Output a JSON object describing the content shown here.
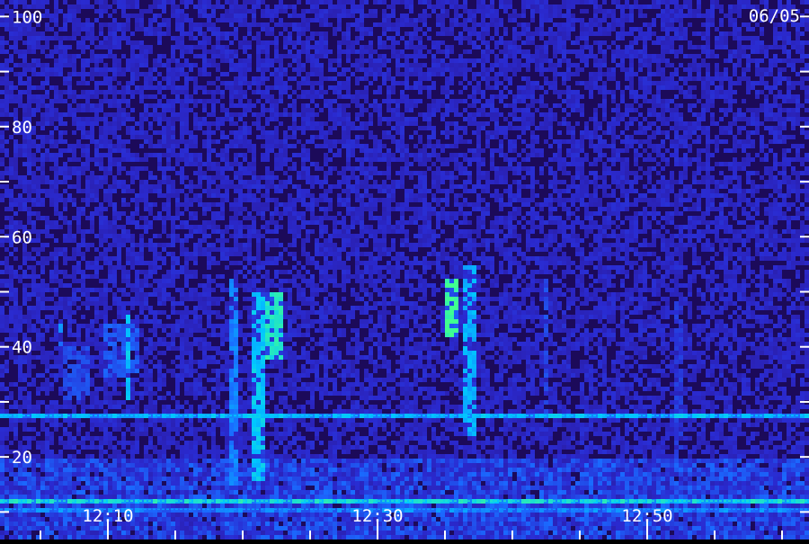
{
  "chart_data": {
    "type": "heatmap",
    "title": "",
    "date_label": "06/05",
    "xlabel": "",
    "ylabel": "",
    "x_tick_labels": [
      "12:10",
      "12:30",
      "12:50"
    ],
    "x_tick_minutes": [
      10,
      30,
      50
    ],
    "x_range_minutes": [
      2,
      62
    ],
    "x_minor_step_minutes": 5,
    "y_tick_labels": [
      "20",
      "40",
      "60",
      "80",
      "100"
    ],
    "y_ticks": [
      20,
      40,
      60,
      80,
      100
    ],
    "y_minor_ticks": [
      10,
      30,
      50,
      70,
      90
    ],
    "ylim": [
      5,
      103
    ],
    "grid": false,
    "colormap": [
      "#0a0330",
      "#2a0f7a",
      "#2a2ad0",
      "#1a6aff",
      "#00c8ff",
      "#40ff90"
    ],
    "features": [
      {
        "kind": "emission_band",
        "t_start": 6.2,
        "t_end": 6.6,
        "f_low": 38,
        "f_high": 44,
        "intensity": 0.6
      },
      {
        "kind": "emission_band",
        "t_start": 6.8,
        "t_end": 8.6,
        "f_low": 30,
        "f_high": 40,
        "intensity": 0.45
      },
      {
        "kind": "emission_band",
        "t_start": 9.6,
        "t_end": 12.2,
        "f_low": 34,
        "f_high": 44,
        "intensity": 0.5
      },
      {
        "kind": "emission_band",
        "t_start": 11.2,
        "t_end": 11.6,
        "f_low": 30,
        "f_high": 46,
        "intensity": 0.75
      },
      {
        "kind": "emission_band",
        "t_start": 19.0,
        "t_end": 19.6,
        "f_low": 15,
        "f_high": 52,
        "intensity": 0.6
      },
      {
        "kind": "emission_band",
        "t_start": 20.8,
        "t_end": 21.6,
        "f_low": 16,
        "f_high": 50,
        "intensity": 0.75
      },
      {
        "kind": "emission_band",
        "t_start": 21.8,
        "t_end": 23.0,
        "f_low": 38,
        "f_high": 50,
        "intensity": 0.85
      },
      {
        "kind": "emission_band",
        "t_start": 35.0,
        "t_end": 36.0,
        "f_low": 42,
        "f_high": 52,
        "intensity": 0.95
      },
      {
        "kind": "emission_band",
        "t_start": 36.2,
        "t_end": 37.4,
        "f_low": 24,
        "f_high": 55,
        "intensity": 0.7
      },
      {
        "kind": "emission_band",
        "t_start": 42.2,
        "t_end": 42.8,
        "f_low": 28,
        "f_high": 52,
        "intensity": 0.45
      },
      {
        "kind": "emission_band",
        "t_start": 52.0,
        "t_end": 52.6,
        "f_low": 18,
        "f_high": 48,
        "intensity": 0.4
      },
      {
        "kind": "noise_band",
        "f_low": 5,
        "f_high": 20,
        "intensity": 0.55
      },
      {
        "kind": "interference_line",
        "f": 27.5,
        "intensity": 0.8
      },
      {
        "kind": "interference_line",
        "f": 12.0,
        "intensity": 0.9
      },
      {
        "kind": "interference_line",
        "f": 10.5,
        "intensity": 0.7
      }
    ]
  }
}
